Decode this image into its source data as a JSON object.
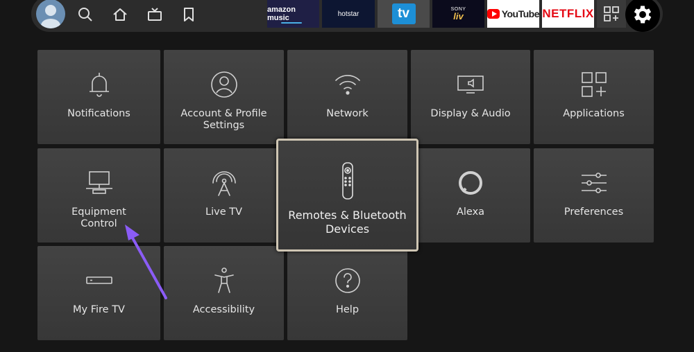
{
  "topbar": {
    "apps": [
      {
        "name": "amazon-music",
        "label": "amazon music"
      },
      {
        "name": "hotstar",
        "label": "hotstar"
      },
      {
        "name": "tv",
        "label": "tv"
      },
      {
        "name": "sony-liv",
        "label_top": "SONY",
        "label_main": "liv"
      },
      {
        "name": "youtube",
        "label": "YouTube"
      },
      {
        "name": "netflix",
        "label": "NETFLIX"
      }
    ]
  },
  "tiles": [
    {
      "label": "Notifications",
      "icon": "bell-icon"
    },
    {
      "label": "Account & Profile\nSettings",
      "icon": "profile-icon"
    },
    {
      "label": "Network",
      "icon": "wifi-icon"
    },
    {
      "label": "Display & Audio",
      "icon": "display-icon"
    },
    {
      "label": "Applications",
      "icon": "apps-grid-icon"
    },
    {
      "label": "Equipment\nControl",
      "icon": "equipment-icon"
    },
    {
      "label": "Live TV",
      "icon": "antenna-icon"
    },
    {
      "label": "Remotes & Bluetooth\nDevices",
      "icon": "remote-icon",
      "focused": true
    },
    {
      "label": "Alexa",
      "icon": "alexa-icon"
    },
    {
      "label": "Preferences",
      "icon": "sliders-icon"
    },
    {
      "label": "My Fire TV",
      "icon": "fire-tv-device-icon"
    },
    {
      "label": "Accessibility",
      "icon": "accessibility-icon"
    },
    {
      "label": "Help",
      "icon": "help-icon"
    }
  ],
  "colors": {
    "background": "#161616",
    "tile": "#3d3d3d",
    "focus_border": "#cfc6b4",
    "annotation_arrow": "#8b5cf6"
  }
}
